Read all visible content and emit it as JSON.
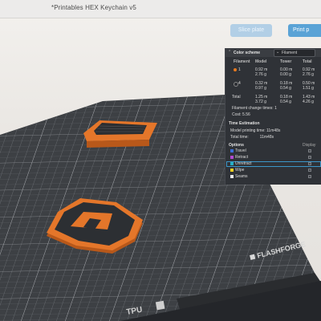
{
  "window": {
    "title": "*Printables HEX Keychain v5"
  },
  "toolbar": {
    "slice_label": "Slice plate",
    "print_label": "Print p"
  },
  "stats": {
    "color_scheme_label": "Color scheme",
    "color_scheme_value": "Filament",
    "columns": {
      "filament": "Filament",
      "model": "Model",
      "tower": "Tower",
      "total": "Total"
    },
    "rows": [
      {
        "id": "1",
        "color": "#e87a1e",
        "model_m": "0.92 m",
        "model_g": "2.76 g",
        "tower_m": "0.00 m",
        "tower_g": "0.00 g",
        "total_m": "0.92 m",
        "total_g": "2.76 g"
      },
      {
        "id": "4",
        "color": "#2b2e33",
        "model_m": "0.32 m",
        "model_g": "0.97 g",
        "tower_m": "0.18 m",
        "tower_g": "0.54 g",
        "total_m": "0.50 m",
        "total_g": "1.51 g"
      }
    ],
    "total_label": "Total",
    "total": {
      "model_m": "1.25 m",
      "model_g": "3.72 g",
      "tower_m": "0.18 m",
      "tower_g": "0.54 g",
      "total_m": "1.43 m",
      "total_g": "4.26 g"
    },
    "filament_changes": "Filament change times: 1",
    "cost": "Cost: 5.56"
  },
  "time": {
    "title": "Time Estimation",
    "model_time": "Model printing time: 11m48s",
    "total_time": "Total time:          11m48s"
  },
  "options": {
    "title": "Options",
    "display_label": "Display",
    "items": [
      {
        "label": "Travel",
        "color": "#3b6fd8"
      },
      {
        "label": "Retract",
        "color": "#b04ad0"
      },
      {
        "label": "Unretract",
        "color": "#26b0c4"
      },
      {
        "label": "Wipe",
        "color": "#f0d020"
      },
      {
        "label": "Seams",
        "color": "#e8e8e8"
      }
    ]
  },
  "bed": {
    "brand": "FLASHFORGE",
    "type_label": "TPU"
  },
  "colors": {
    "accent": "#5aa3d6",
    "filament_orange": "#e87a1e",
    "panel_bg": "#2f3237",
    "bed": "#3c3f43"
  }
}
